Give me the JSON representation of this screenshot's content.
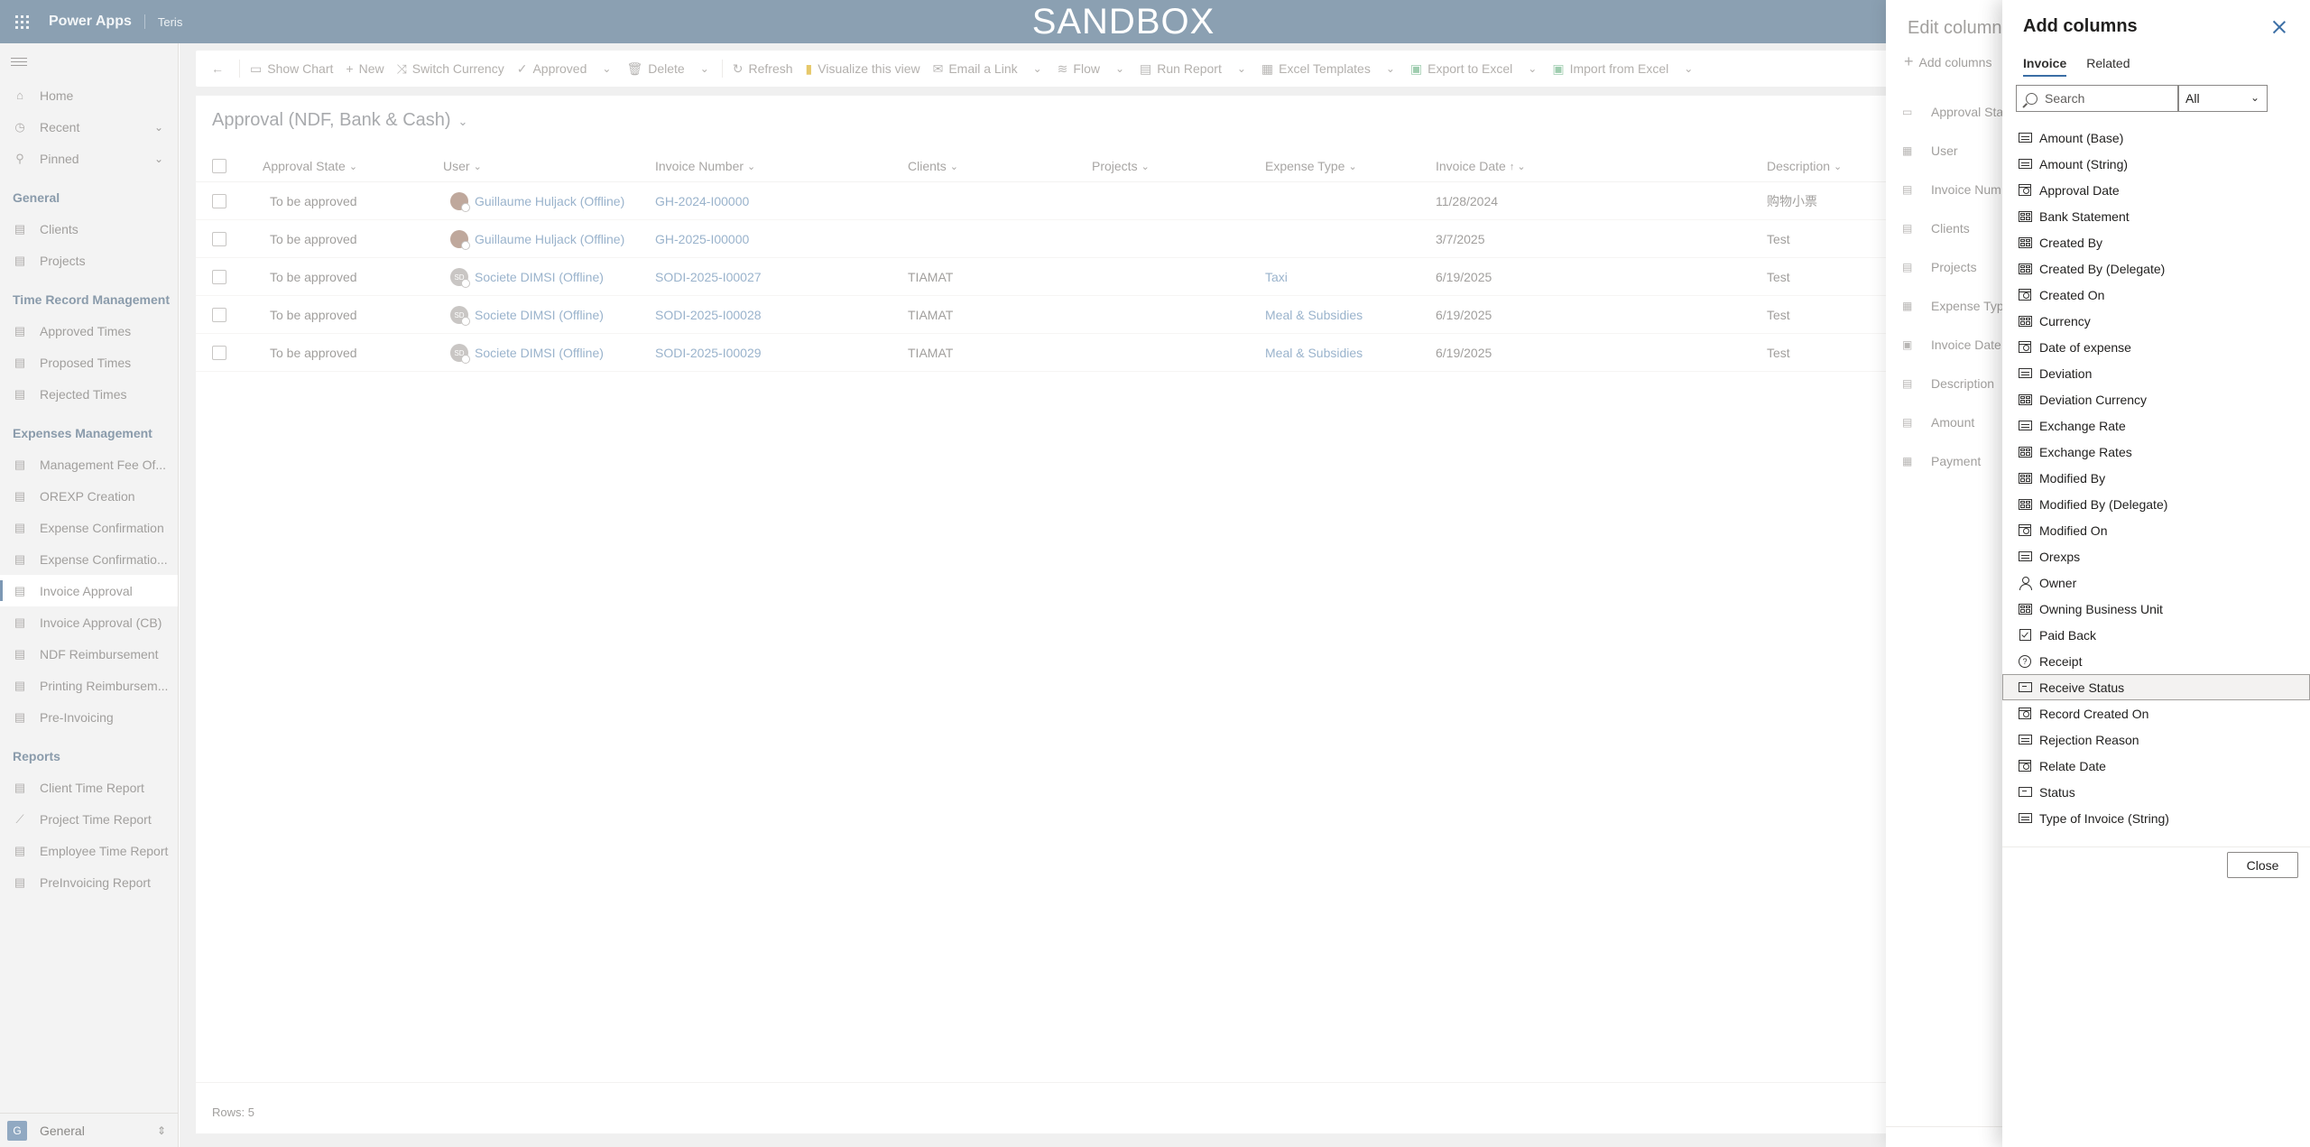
{
  "topbar": {
    "app_name": "Power Apps",
    "env_name": "Teris",
    "banner": "SANDBOX"
  },
  "sidebar": {
    "top_items": [
      {
        "label": "Home",
        "icon": "home-icon"
      },
      {
        "label": "Recent",
        "icon": "clock-icon"
      },
      {
        "label": "Pinned",
        "icon": "pin-icon"
      }
    ],
    "sections": [
      {
        "title": "General",
        "items": [
          "Clients",
          "Projects"
        ]
      },
      {
        "title": "Time Record Management",
        "items": [
          "Approved Times",
          "Proposed Times",
          "Rejected Times"
        ]
      },
      {
        "title": "Expenses Management",
        "items": [
          "Management Fee Of...",
          "OREXP Creation",
          "Expense Confirmation",
          "Expense Confirmatio...",
          "Invoice Approval",
          "Invoice Approval (CB)",
          "NDF Reimbursement",
          "Printing Reimbursem...",
          "Pre-Invoicing"
        ]
      },
      {
        "title": "Reports",
        "items": [
          "Client Time Report",
          "Project Time Report",
          "Employee Time Report",
          "PreInvoicing Report"
        ]
      }
    ],
    "selected": "Invoice Approval",
    "area": {
      "badge": "G",
      "label": "General"
    }
  },
  "commandbar": {
    "show_chart": "Show Chart",
    "new": "New",
    "switch_currency": "Switch Currency",
    "approved": "Approved",
    "delete": "Delete",
    "refresh": "Refresh",
    "visualize": "Visualize this view",
    "email_link": "Email a Link",
    "flow": "Flow",
    "run_report": "Run Report",
    "excel_templates": "Excel Templates",
    "export_excel": "Export to Excel",
    "import_excel": "Import from Excel"
  },
  "grid": {
    "view_title": "Approval (NDF, Bank & Cash)",
    "columns": [
      "Approval State",
      "User",
      "Invoice Number",
      "Clients",
      "Projects",
      "Expense Type",
      "Invoice Date",
      "Description"
    ],
    "rows": [
      {
        "state": "To be approved",
        "user": "Guillaume Huljack (Offline)",
        "avatar": "",
        "invoice": "GH-2024-I00000",
        "clients": "",
        "projects": "",
        "expense_type": "",
        "date": "11/28/2024",
        "description": "购物小票"
      },
      {
        "state": "To be approved",
        "user": "Guillaume Huljack (Offline)",
        "avatar": "",
        "invoice": "GH-2025-I00000",
        "clients": "",
        "projects": "",
        "expense_type": "",
        "date": "3/7/2025",
        "description": "Test"
      },
      {
        "state": "To be approved",
        "user": "Societe DIMSI (Offline)",
        "avatar": "SD",
        "invoice": "SODI-2025-I00027",
        "clients": "TIAMAT",
        "projects": "",
        "expense_type": "Taxi",
        "date": "6/19/2025",
        "description": "Test"
      },
      {
        "state": "To be approved",
        "user": "Societe DIMSI (Offline)",
        "avatar": "SD",
        "invoice": "SODI-2025-I00028",
        "clients": "TIAMAT",
        "projects": "",
        "expense_type": "Meal & Subsidies",
        "date": "6/19/2025",
        "description": "Test"
      },
      {
        "state": "To be approved",
        "user": "Societe DIMSI (Offline)",
        "avatar": "SD",
        "invoice": "SODI-2025-I00029",
        "clients": "TIAMAT",
        "projects": "",
        "expense_type": "Meal & Subsidies",
        "date": "6/19/2025",
        "description": "Test"
      }
    ],
    "rows_count": "Rows: 5"
  },
  "edit_columns": {
    "title": "Edit column",
    "add_label": "Add columns",
    "items": [
      {
        "label": "Approval Sta",
        "icon": "status-icon"
      },
      {
        "label": "User",
        "icon": "lookup-icon"
      },
      {
        "label": "Invoice Num",
        "icon": "text-icon"
      },
      {
        "label": "Clients",
        "icon": "text-icon"
      },
      {
        "label": "Projects",
        "icon": "text-icon"
      },
      {
        "label": "Expense Typ",
        "icon": "lookup-icon"
      },
      {
        "label": "Invoice Date",
        "icon": "date-icon"
      },
      {
        "label": "Description",
        "icon": "text-icon"
      },
      {
        "label": "Amount",
        "icon": "text-icon"
      },
      {
        "label": "Payment",
        "icon": "lookup-icon"
      }
    ]
  },
  "add_columns": {
    "title": "Add columns",
    "tabs": [
      "Invoice",
      "Related"
    ],
    "active_tab": "Invoice",
    "search_placeholder": "Search",
    "filter_value": "All",
    "close_label": "Close",
    "focused": "Receive Status",
    "items": [
      {
        "label": "Amount (Base)",
        "icon": "text-icon"
      },
      {
        "label": "Amount (String)",
        "icon": "text-icon"
      },
      {
        "label": "Approval Date",
        "icon": "date-icon"
      },
      {
        "label": "Bank Statement",
        "icon": "lookup-icon"
      },
      {
        "label": "Created By",
        "icon": "lookup-icon"
      },
      {
        "label": "Created By (Delegate)",
        "icon": "lookup-icon"
      },
      {
        "label": "Created On",
        "icon": "date-icon"
      },
      {
        "label": "Currency",
        "icon": "lookup-icon"
      },
      {
        "label": "Date of expense",
        "icon": "date-icon"
      },
      {
        "label": "Deviation",
        "icon": "text-icon"
      },
      {
        "label": "Deviation Currency",
        "icon": "lookup-icon"
      },
      {
        "label": "Exchange Rate",
        "icon": "text-icon"
      },
      {
        "label": "Exchange Rates",
        "icon": "lookup-icon"
      },
      {
        "label": "Modified By",
        "icon": "lookup-icon"
      },
      {
        "label": "Modified By (Delegate)",
        "icon": "lookup-icon"
      },
      {
        "label": "Modified On",
        "icon": "date-icon"
      },
      {
        "label": "Orexps",
        "icon": "text-icon"
      },
      {
        "label": "Owner",
        "icon": "person-icon"
      },
      {
        "label": "Owning Business Unit",
        "icon": "lookup-icon"
      },
      {
        "label": "Paid Back",
        "icon": "checkbox-icon"
      },
      {
        "label": "Receipt",
        "icon": "choice-icon"
      },
      {
        "label": "Receive Status",
        "icon": "status-icon"
      },
      {
        "label": "Record Created On",
        "icon": "date-icon"
      },
      {
        "label": "Rejection Reason",
        "icon": "text-icon"
      },
      {
        "label": "Relate Date",
        "icon": "date-icon"
      },
      {
        "label": "Status",
        "icon": "status-icon"
      },
      {
        "label": "Type of Invoice (String)",
        "icon": "text-icon"
      }
    ]
  }
}
